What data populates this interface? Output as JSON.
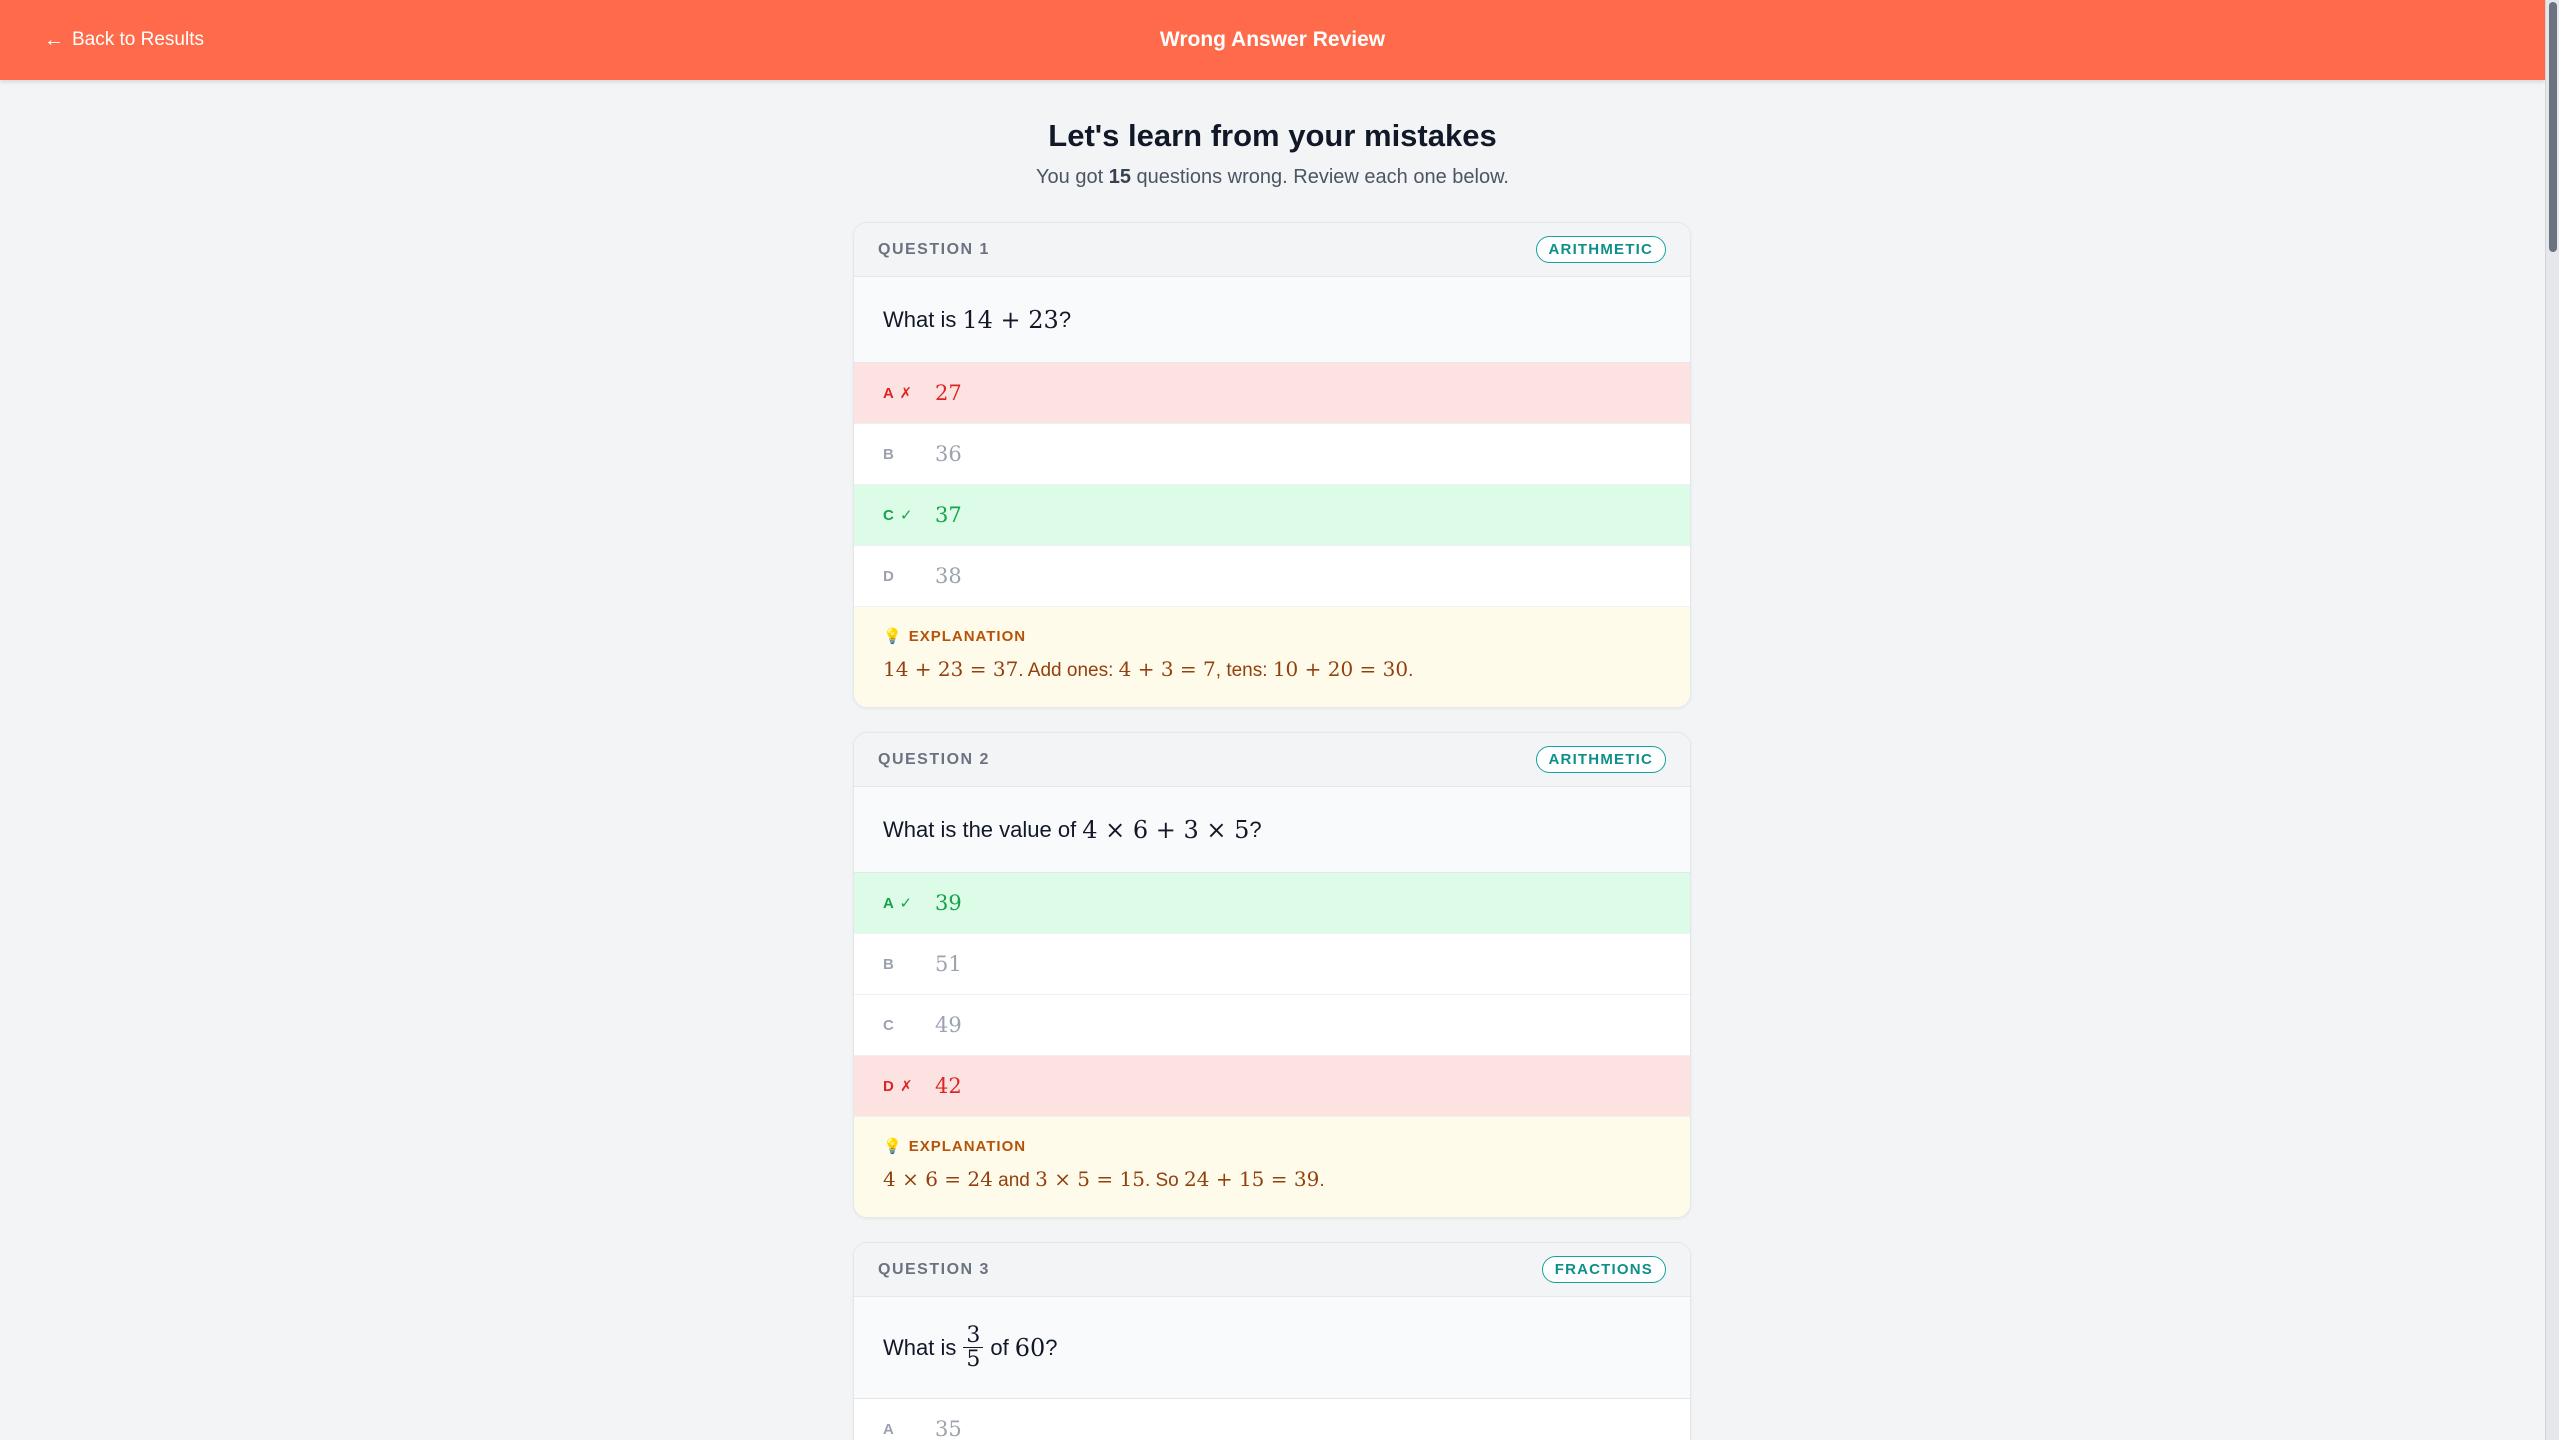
{
  "header": {
    "back_label": "Back to Results",
    "title": "Wrong Answer Review"
  },
  "intro": {
    "heading": "Let's learn from your mistakes",
    "sub_prefix": "You got ",
    "wrong_count": "15",
    "sub_suffix": " questions wrong. Review each one below."
  },
  "questions": [
    {
      "label": "QUESTION 1",
      "tag": "ARITHMETIC",
      "prompt_before": "What is",
      "prompt_math": "14 + 23",
      "prompt_after": "?",
      "options": [
        {
          "letter": "A ✗",
          "value": "27",
          "status": "wrong"
        },
        {
          "letter": "B",
          "value": "36",
          "status": "neutral"
        },
        {
          "letter": "C ✓",
          "value": "37",
          "status": "right"
        },
        {
          "letter": "D",
          "value": "38",
          "status": "neutral"
        }
      ],
      "explanation_title": "EXPLANATION",
      "explanation": [
        {
          "m": "14 + 23 = 37"
        },
        {
          "t": ". Add ones: "
        },
        {
          "m": "4 + 3 = 7"
        },
        {
          "t": ", tens: "
        },
        {
          "m": "10 + 20 = 30"
        },
        {
          "t": "."
        }
      ]
    },
    {
      "label": "QUESTION 2",
      "tag": "ARITHMETIC",
      "prompt_before": "What is the value of",
      "prompt_math": "4 × 6 + 3 × 5",
      "prompt_after": "?",
      "options": [
        {
          "letter": "A ✓",
          "value": "39",
          "status": "right"
        },
        {
          "letter": "B",
          "value": "51",
          "status": "neutral"
        },
        {
          "letter": "C",
          "value": "49",
          "status": "neutral"
        },
        {
          "letter": "D ✗",
          "value": "42",
          "status": "wrong"
        }
      ],
      "explanation_title": "EXPLANATION",
      "explanation": [
        {
          "m": "4 × 6 = 24"
        },
        {
          "t": " and "
        },
        {
          "m": "3 × 5 = 15"
        },
        {
          "t": ". So "
        },
        {
          "m": "24 + 15 = 39"
        },
        {
          "t": "."
        }
      ]
    },
    {
      "label": "QUESTION 3",
      "tag": "FRACTIONS",
      "prompt_before": "What is",
      "frac_num": "3",
      "frac_den": "5",
      "prompt_mid": "of",
      "prompt_math": "60",
      "prompt_after": "?",
      "options": [
        {
          "letter": "A",
          "value": "35",
          "status": "neutral"
        }
      ]
    }
  ],
  "icons": {
    "back": "arrow-left-icon",
    "explanation": "lightbulb-icon"
  },
  "colors": {
    "header_bg": "#ff6b4a",
    "wrong_bg": "#fde2e2",
    "right_bg": "#dcfce7",
    "explain_bg": "#fffbeb",
    "tag_color": "#0f8f8a"
  }
}
